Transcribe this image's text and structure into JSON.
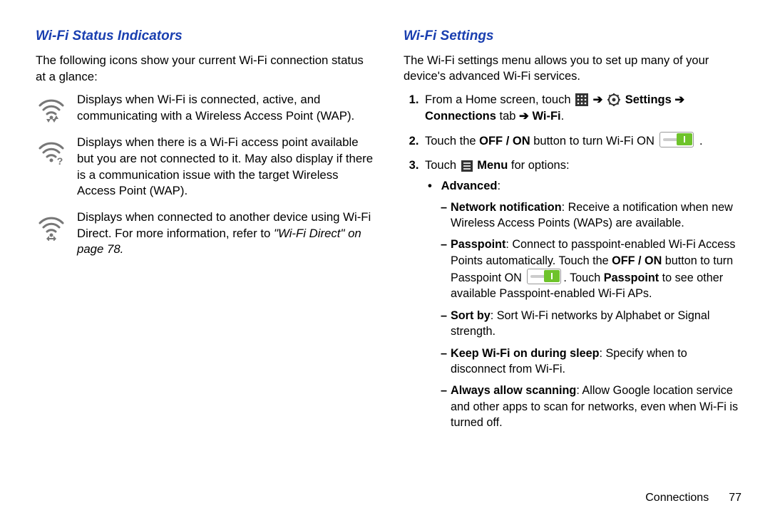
{
  "left": {
    "title": "Wi-Fi Status Indicators",
    "intro": "The following icons show your current Wi-Fi connection status at a glance:",
    "items": [
      {
        "icon": "wifi-active-icon",
        "text": "Displays when Wi-Fi is connected, active, and communicating with a Wireless Access Point (WAP)."
      },
      {
        "icon": "wifi-available-icon",
        "text": "Displays when there is a Wi-Fi access point available but you are not connected to it. May also display if there is a communication issue with the target Wireless Access Point (WAP)."
      },
      {
        "icon": "wifi-direct-icon",
        "text_prefix": "Displays when connected to another device using Wi-Fi Direct. For more information, refer to ",
        "ref": "\"Wi-Fi Direct\"",
        "text_suffix": " on page 78."
      }
    ]
  },
  "right": {
    "title": "Wi-Fi Settings",
    "intro": "The Wi-Fi settings menu allows you to set up many of your device's advanced Wi-Fi services.",
    "step1_prefix": "From a Home screen, touch ",
    "step1_settings": " Settings ",
    "step1_connections": "Connections",
    "step1_tab": " tab ",
    "step1_wifi": " Wi-Fi",
    "step2_prefix": "Touch the ",
    "step2_offon": "OFF / ON",
    "step2_mid": " button to turn Wi-Fi ON ",
    "step3_prefix": "Touch ",
    "step3_menu": " Menu",
    "step3_suffix": " for options:",
    "advanced_label": "Advanced",
    "adv": {
      "net_title": "Network notification",
      "net_body": ": Receive a notification when new Wireless Access Points (WAPs) are available.",
      "pass_title": "Passpoint",
      "pass_a": ": Connect to passpoint-enabled Wi-Fi Access Points automatically. Touch the ",
      "pass_offon": "OFF / ON",
      "pass_b": " button to turn Passpoint ON ",
      "pass_c": ". Touch ",
      "pass_word": "Passpoint",
      "pass_d": " to see other available Passpoint-enabled Wi-Fi APs.",
      "sort_title": "Sort by",
      "sort_body": ": Sort Wi-Fi networks by Alphabet or Signal strength.",
      "keep_title": "Keep Wi-Fi on during sleep",
      "keep_body": ": Specify when to disconnect from Wi-Fi.",
      "scan_title": "Always allow scanning",
      "scan_body": ": Allow Google location service and other apps to scan for networks, even when Wi-Fi is turned off."
    }
  },
  "footer": {
    "section": "Connections",
    "page": "77"
  }
}
